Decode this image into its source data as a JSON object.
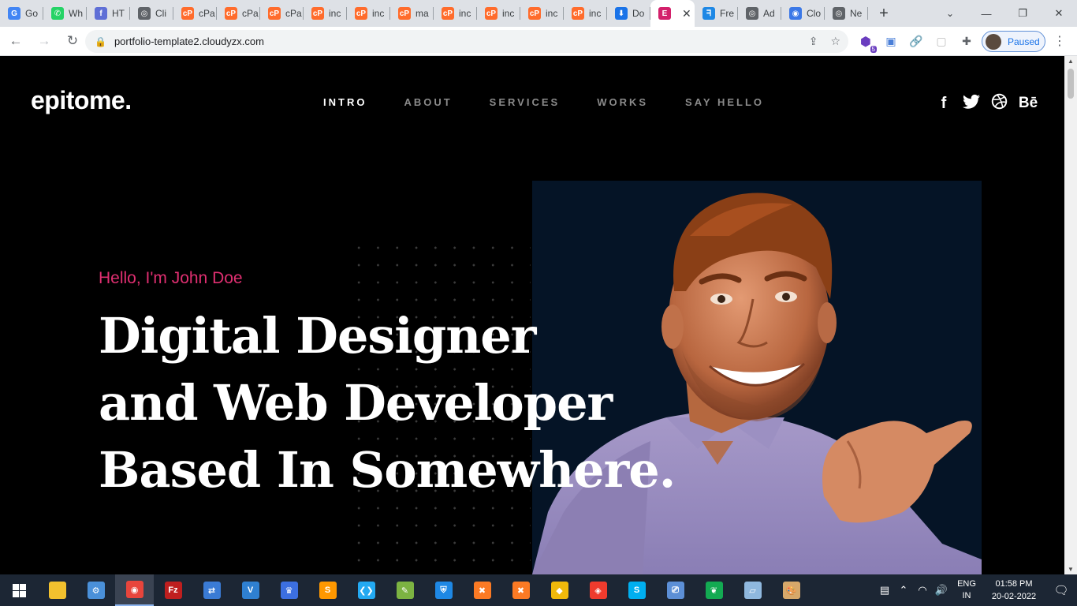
{
  "browser": {
    "tabs": [
      {
        "label": "Go",
        "icon": "google-icon",
        "color": "#4285f4",
        "glyph": "G"
      },
      {
        "label": "Wh",
        "icon": "whatsapp-icon",
        "color": "#25d366",
        "glyph": "✆"
      },
      {
        "label": "HT",
        "icon": "f-icon",
        "color": "#5f6fd6",
        "glyph": "f"
      },
      {
        "label": "Cli",
        "icon": "globe-icon",
        "color": "#5f6368",
        "glyph": "◎"
      },
      {
        "label": "cPa",
        "icon": "cpanel-icon",
        "color": "#ff6c2c",
        "glyph": "cP"
      },
      {
        "label": "cPa",
        "icon": "cpanel-icon",
        "color": "#ff6c2c",
        "glyph": "cP"
      },
      {
        "label": "cPa",
        "icon": "cpanel-icon",
        "color": "#ff6c2c",
        "glyph": "cP"
      },
      {
        "label": "inc",
        "icon": "cpanel-icon",
        "color": "#ff6c2c",
        "glyph": "cP"
      },
      {
        "label": "inc",
        "icon": "cpanel-icon",
        "color": "#ff6c2c",
        "glyph": "cP"
      },
      {
        "label": "ma",
        "icon": "cpanel-icon",
        "color": "#ff6c2c",
        "glyph": "cP"
      },
      {
        "label": "inc",
        "icon": "cpanel-icon",
        "color": "#ff6c2c",
        "glyph": "cP"
      },
      {
        "label": "inc",
        "icon": "cpanel-icon",
        "color": "#ff6c2c",
        "glyph": "cP"
      },
      {
        "label": "inc",
        "icon": "cpanel-icon",
        "color": "#ff6c2c",
        "glyph": "cP"
      },
      {
        "label": "inc",
        "icon": "cpanel-icon",
        "color": "#ff6c2c",
        "glyph": "cP"
      },
      {
        "label": "Do",
        "icon": "download-icon",
        "color": "#1a73e8",
        "glyph": "⬇"
      },
      {
        "label": "",
        "icon": "elementor-icon",
        "color": "#d3216b",
        "glyph": "E",
        "active": true
      },
      {
        "label": "Fre",
        "icon": "f-brand-icon",
        "color": "#1e88e5",
        "glyph": "ᖷ"
      },
      {
        "label": "Ad",
        "icon": "globe-icon",
        "color": "#5f6368",
        "glyph": "◎"
      },
      {
        "label": "Clo",
        "icon": "globe-blue-icon",
        "color": "#3b78e7",
        "glyph": "◉"
      },
      {
        "label": "Ne",
        "icon": "chrome-icon",
        "color": "#5f6368",
        "glyph": "◎"
      }
    ],
    "url": "portfolio-template2.cloudyzx.com",
    "profile_label": "Paused",
    "ext_badge": "5"
  },
  "site": {
    "logo": "epitome.",
    "nav": [
      "INTRO",
      "ABOUT",
      "SERVICES",
      "WORKS",
      "SAY HELLO"
    ],
    "social": [
      {
        "icon": "facebook-icon",
        "glyph": "f"
      },
      {
        "icon": "twitter-icon",
        "glyph": "🐦"
      },
      {
        "icon": "dribbble-icon",
        "glyph": "⊛"
      },
      {
        "icon": "behance-icon",
        "glyph": "Bē"
      }
    ],
    "greeting": "Hello, I'm John Doe",
    "headline": [
      "Digital Designer",
      "and Web Developer",
      "Based In Somewhere."
    ]
  },
  "taskbar": {
    "apps": [
      {
        "icon": "file-explorer-icon",
        "color": "#f2c12e",
        "glyph": ""
      },
      {
        "icon": "network-app-icon",
        "color": "#4a90d9",
        "glyph": "⚙"
      },
      {
        "icon": "chrome-icon",
        "color": "#e8453c",
        "glyph": "◉",
        "active": true
      },
      {
        "icon": "filezilla-icon",
        "color": "#bf1f1f",
        "glyph": "Fz"
      },
      {
        "icon": "network-tool-icon",
        "color": "#3a7bd5",
        "glyph": "⇄"
      },
      {
        "icon": "vs-app-icon",
        "color": "#2f80d1",
        "glyph": "V"
      },
      {
        "icon": "crown-app-icon",
        "color": "#3c6fe0",
        "glyph": "♛"
      },
      {
        "icon": "sublime-icon",
        "color": "#ff9800",
        "glyph": "S"
      },
      {
        "icon": "vscode-icon",
        "color": "#23a9f2",
        "glyph": "❮❯"
      },
      {
        "icon": "notepad-icon",
        "color": "#7cb342",
        "glyph": "✎"
      },
      {
        "icon": "shield-app-icon",
        "color": "#1e88e5",
        "glyph": "⛨"
      },
      {
        "icon": "xampp-icon",
        "color": "#fb7a24",
        "glyph": "✖"
      },
      {
        "icon": "xampp-icon-2",
        "color": "#fb7a24",
        "glyph": "✖"
      },
      {
        "icon": "binance-icon",
        "color": "#f0b90b",
        "glyph": "◆"
      },
      {
        "icon": "anydesk-icon",
        "color": "#ef3b2d",
        "glyph": "◈"
      },
      {
        "icon": "skype-icon",
        "color": "#00aff0",
        "glyph": "S"
      },
      {
        "icon": "remote-desktop-icon",
        "color": "#5c8fd6",
        "glyph": "⎚"
      },
      {
        "icon": "mongodb-icon",
        "color": "#13aa52",
        "glyph": "❦"
      },
      {
        "icon": "sticky-app-icon",
        "color": "#8fb8de",
        "glyph": "▱"
      },
      {
        "icon": "paint-icon",
        "color": "#d6a86a",
        "glyph": "🎨"
      }
    ],
    "lang_top": "ENG",
    "lang_bottom": "IN",
    "time": "01:58 PM",
    "date": "20-02-2022"
  }
}
